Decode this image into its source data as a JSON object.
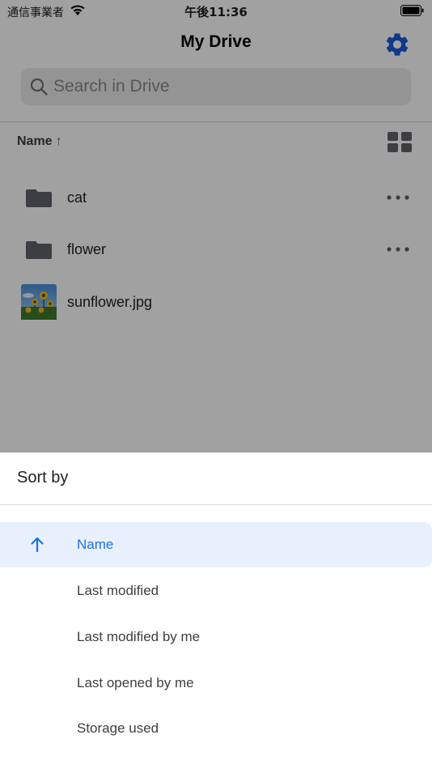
{
  "status_bar": {
    "carrier": "通信事業者",
    "time": "午後11:36",
    "icons": [
      "wifi-icon",
      "battery-icon"
    ]
  },
  "header": {
    "title": "My Drive",
    "settings_icon": "gear-icon"
  },
  "search": {
    "placeholder": "Search in Drive",
    "icon": "search-icon"
  },
  "list_header": {
    "sort_label": "Name",
    "sort_direction_glyph": "↑",
    "view_toggle_icon": "grid-view-icon"
  },
  "files": [
    {
      "name": "cat",
      "type": "folder",
      "icon": "folder-icon",
      "more_icon": "more-horizontal-icon"
    },
    {
      "name": "flower",
      "type": "folder",
      "icon": "folder-icon",
      "more_icon": "more-horizontal-icon"
    },
    {
      "name": "sunflower.jpg",
      "type": "image",
      "icon": "image-thumbnail"
    }
  ],
  "sort_sheet": {
    "title": "Sort by",
    "options": [
      {
        "label": "Name",
        "selected": true,
        "icon": "arrow-up-icon"
      },
      {
        "label": "Last modified",
        "selected": false
      },
      {
        "label": "Last modified by me",
        "selected": false
      },
      {
        "label": "Last opened by me",
        "selected": false
      },
      {
        "label": "Storage used",
        "selected": false
      }
    ]
  },
  "colors": {
    "accent": "#1a73e8",
    "gear": "#1e5bd6",
    "selected_bg": "#e8f0fe",
    "overlay": "rgba(0,0,0,0.37)"
  }
}
